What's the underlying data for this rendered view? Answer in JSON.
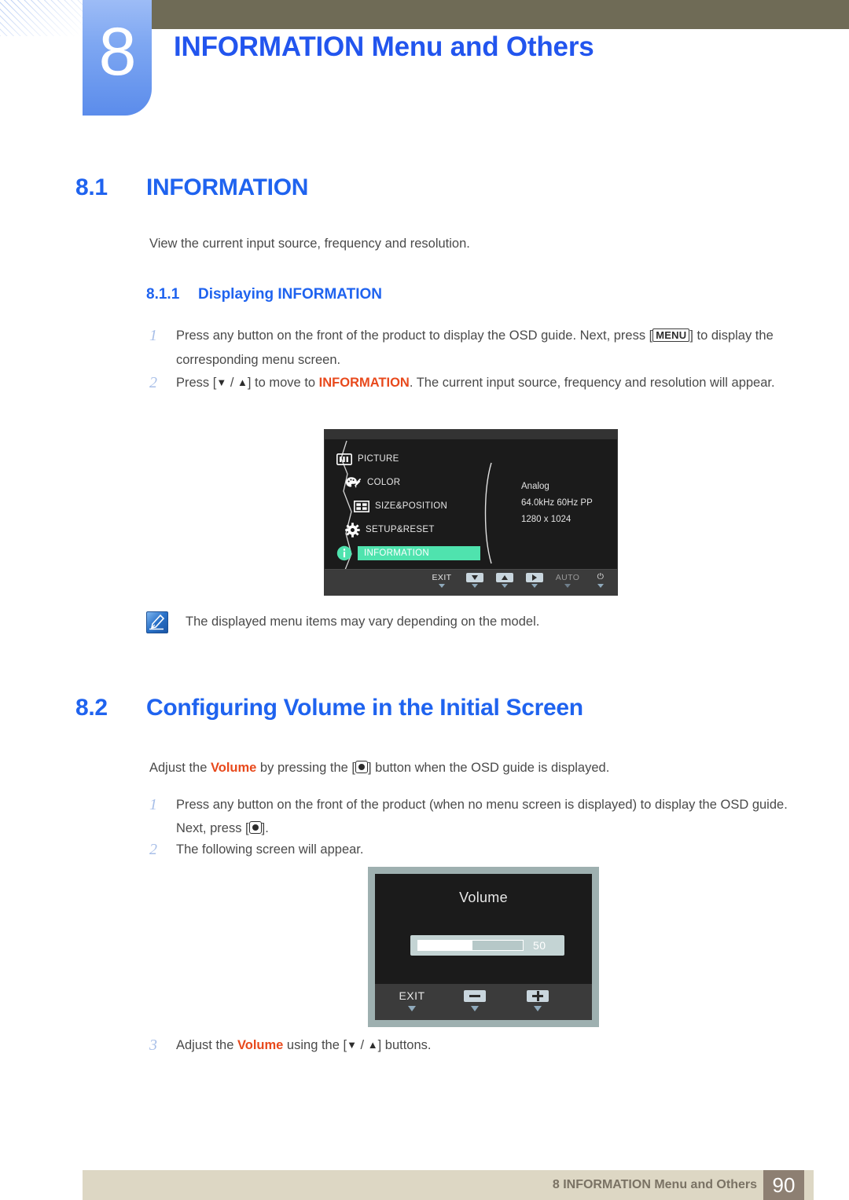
{
  "header": {
    "chapter_number": "8",
    "chapter_title": "INFORMATION Menu and Others"
  },
  "sections": {
    "s81": {
      "number": "8.1",
      "title": "INFORMATION",
      "intro": "View the current input source, frequency and resolution.",
      "sub": {
        "number": "8.1.1",
        "title": "Displaying INFORMATION"
      },
      "steps": {
        "one_num": "1",
        "one_a": "Press any button on the front of the product to display the OSD guide. Next, press [",
        "one_key": "MENU",
        "one_b": "] to display the corresponding menu screen.",
        "two_num": "2",
        "two_a": "Press [",
        "two_down": "▼",
        "two_slash": " / ",
        "two_up": "▲",
        "two_b": "] to move to ",
        "two_hot": "INFORMATION",
        "two_c": ". The current input source, frequency and resolution will appear."
      },
      "note": "The displayed menu items may vary depending on the model."
    },
    "s82": {
      "number": "8.2",
      "title": "Configuring Volume in the Initial Screen",
      "intro_a": "Adjust the ",
      "intro_hot": "Volume",
      "intro_b": " by pressing the [",
      "intro_c": "] button when the OSD guide is displayed.",
      "steps": {
        "one_num": "1",
        "one_a": "Press any button on the front of the product (when no menu screen is displayed) to display the OSD guide. Next, press [",
        "one_b": "].",
        "two_num": "2",
        "two_text": "The following screen will appear.",
        "three_num": "3",
        "three_a": "Adjust the ",
        "three_hot": "Volume",
        "three_b": " using the [",
        "three_down": "▼",
        "three_slash": " / ",
        "three_up": "▲",
        "three_c": "] buttons."
      }
    }
  },
  "osd_menu": {
    "items": [
      {
        "label": "PICTURE",
        "icon": "picture-icon",
        "selected": false
      },
      {
        "label": "COLOR",
        "icon": "palette-icon",
        "selected": false
      },
      {
        "label": "SIZE&POSITION",
        "icon": "size-position-icon",
        "selected": false
      },
      {
        "label": "SETUP&RESET",
        "icon": "gear-icon",
        "selected": false
      },
      {
        "label": "INFORMATION",
        "icon": "info-icon",
        "selected": true
      }
    ],
    "info_lines": {
      "source": "Analog",
      "frequency": "64.0kHz 60Hz PP",
      "resolution": "1280 x 1024"
    },
    "bottom_buttons": {
      "exit": "EXIT",
      "down": "down-arrow-key",
      "up": "up-arrow-key",
      "enter": "right-arrow-key",
      "auto": "AUTO",
      "power": "⏻"
    },
    "highlight_color": "#4fe3ae"
  },
  "osd_volume": {
    "title": "Volume",
    "value": "50",
    "fill_percent": 52,
    "bottom_buttons": {
      "exit": "EXIT",
      "minus": "minus-key",
      "plus": "plus-key"
    }
  },
  "footer": {
    "text": "8 INFORMATION Menu and Others",
    "page": "90"
  }
}
